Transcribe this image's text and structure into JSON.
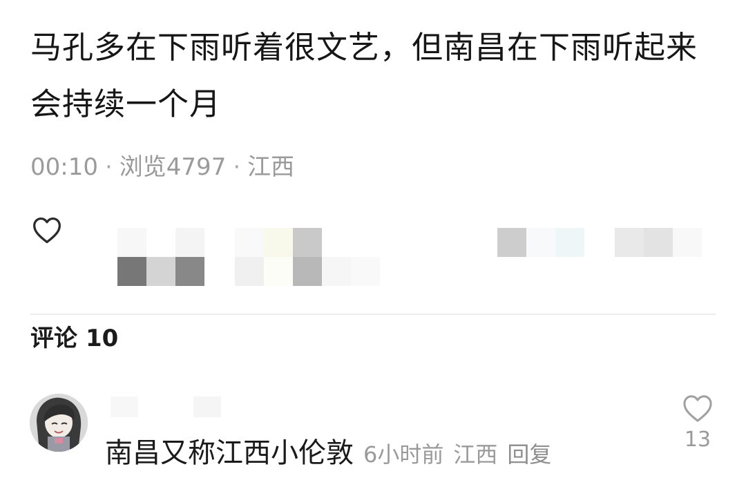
{
  "post": {
    "text": "马孔多在下雨听着很文艺，但南昌在下雨听起来会持续一个月",
    "time": "00:10",
    "views": "浏览4797",
    "location": "江西"
  },
  "icons": {
    "post_like": "heart-outline-icon",
    "comment_like": "heart-outline-icon"
  },
  "comments": {
    "label": "评论",
    "count": "10",
    "items": [
      {
        "text": "南昌又称江西小伦敦",
        "time": "6小时前",
        "location": "江西",
        "reply_label": "回复",
        "likes": "13"
      }
    ]
  },
  "colors": {
    "text": "#161616",
    "meta": "#9a9a9a",
    "divider": "#ececec"
  }
}
